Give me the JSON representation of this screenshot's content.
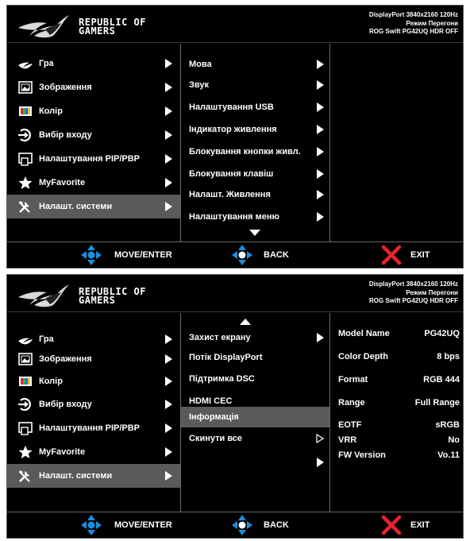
{
  "header": {
    "brand_line1": "REPUBLIC OF",
    "brand_line2": "GAMERS",
    "status_line1": "DisplayPort 3840x2160 120Hz",
    "status_line2": "Режим Перегони",
    "status_line3": "ROG Swift PG42UQ HDR OFF"
  },
  "main_menu": [
    {
      "label": "Гра",
      "icon": "rog-eye-icon"
    },
    {
      "label": "Зображення",
      "icon": "image-icon"
    },
    {
      "label": "Колір",
      "icon": "color-palette-icon"
    },
    {
      "label": "Вибір входу",
      "icon": "input-select-icon"
    },
    {
      "label": "Налаштування PIP/PBP",
      "icon": "pip-pbp-icon"
    },
    {
      "label": "MyFavorite",
      "icon": "star-icon"
    },
    {
      "label": "Налашт. системи",
      "icon": "tools-icon",
      "selected": true
    }
  ],
  "panel1": {
    "submenu": [
      "Мова",
      "Звук",
      "Налаштування USB",
      "Індикатор живлення",
      "Блокування кнопки живл.",
      "Блокування клавіш",
      "Налашт. Живлення",
      "Налаштування меню"
    ]
  },
  "panel2": {
    "submenu": [
      "Захист екрану",
      "Потік DisplayPort",
      "Підтримка DSC",
      "HDMI CEC",
      "Інформація",
      "Скинути все"
    ],
    "selected_submenu": "Інформація",
    "info": [
      {
        "key": "Model Name",
        "value": "PG42UQ"
      },
      {
        "key": "Color Depth",
        "value": "8  bps"
      },
      {
        "key": "Format",
        "value": "RGB 444"
      },
      {
        "key": "Range",
        "value": "Full Range"
      },
      {
        "key": "EOTF",
        "value": "sRGB"
      },
      {
        "key": "VRR",
        "value": "No"
      },
      {
        "key": "FW Version",
        "value": "Vo.11"
      }
    ]
  },
  "footer": {
    "move_label": "MOVE/ENTER",
    "back_label": "BACK",
    "exit_label": "EXIT"
  },
  "colors": {
    "background": "#000000",
    "selected_row": "#5a5a5a",
    "nav_arrow": "#1a8fe0",
    "exit_x": "#e8232d"
  }
}
